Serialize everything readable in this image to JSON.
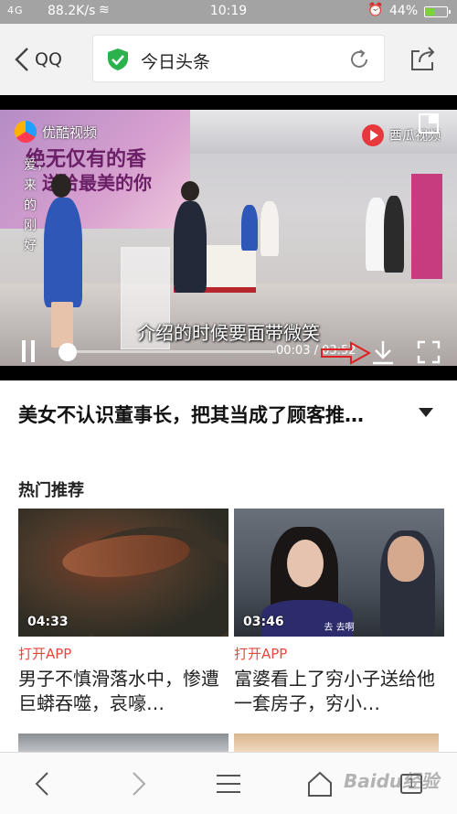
{
  "status_bar": {
    "signal": "4G",
    "network_speed": "88.2K/s",
    "time": "10:19",
    "battery_percent": "44%",
    "battery_level": 0.44,
    "icons": [
      "signal-icon",
      "wifi-icon",
      "alarm-icon",
      "battery-icon"
    ]
  },
  "nav": {
    "back_label": "QQ",
    "page_title": "今日头条",
    "secure_color": "#2bb24c",
    "icons": [
      "chevron-left-icon",
      "shield-check-icon",
      "reload-icon",
      "share-icon"
    ]
  },
  "video": {
    "source_left": "优酷视频",
    "side_text": "爱，来的刚好",
    "source_right": "西瓜视频",
    "banner_line1": "绝无仅有的香",
    "banner_line2": "送给最美的你",
    "subtitle": "介绍的时候要面带微笑",
    "time_display": "00:03 / 03:52",
    "progress": 0.013,
    "icons": [
      "pause-icon",
      "download-icon",
      "fullscreen-icon",
      "mini-window-icon"
    ],
    "annotation_color": "#e02020"
  },
  "title": "美女不认识董事长，把其当成了顾客推…",
  "section": {
    "title": "热门推荐"
  },
  "cards": [
    {
      "duration": "04:33",
      "open_label": "打开APP",
      "title": "男子不慎滑落水中，惨遭巨蟒吞噬，哀嚎…"
    },
    {
      "duration": "03:46",
      "open_label": "打开APP",
      "title": "富婆看上了穷小子送给他一套房子，穷小…",
      "caption": "去 去啊"
    }
  ],
  "bottom_bar": {
    "tabs_count": "1",
    "watermark": "Baidu经验",
    "icons": [
      "back-icon",
      "forward-icon",
      "menu-icon",
      "home-icon",
      "tabs-icon"
    ]
  },
  "colors": {
    "accent_red": "#e8473f",
    "status_bar": "#a3a3a3"
  }
}
